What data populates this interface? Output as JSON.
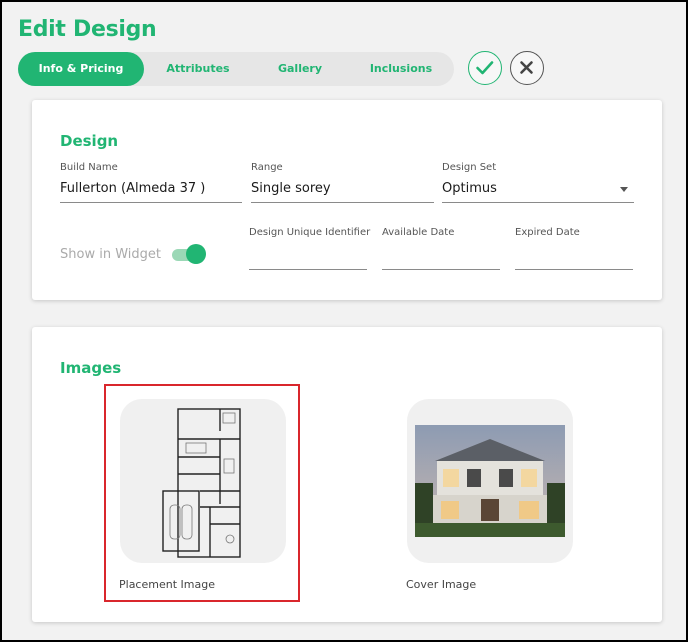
{
  "header": {
    "title": "Edit Design",
    "tabs": [
      {
        "label": "Info & Pricing",
        "active": true
      },
      {
        "label": "Attributes",
        "active": false
      },
      {
        "label": "Gallery",
        "active": false
      },
      {
        "label": "Inclusions",
        "active": false
      }
    ],
    "confirm_icon": "check-icon",
    "cancel_icon": "close-icon",
    "accent_color": "#21b573"
  },
  "design": {
    "section_title": "Design",
    "build_name": {
      "label": "Build Name",
      "value": "Fullerton (Almeda 37 )"
    },
    "range": {
      "label": "Range",
      "value": "Single sorey"
    },
    "design_set": {
      "label": "Design Set",
      "value": "Optimus"
    },
    "show_in_widget": {
      "label": "Show in Widget",
      "on": true
    },
    "design_unique_identifier": {
      "label": "Design Unique Identifier",
      "value": ""
    },
    "available_date": {
      "label": "Available Date",
      "value": ""
    },
    "expired_date": {
      "label": "Expired Date",
      "value": ""
    }
  },
  "images": {
    "section_title": "Images",
    "placement": {
      "caption": "Placement Image",
      "highlight_color": "#d9262c"
    },
    "cover": {
      "caption": "Cover Image"
    }
  }
}
